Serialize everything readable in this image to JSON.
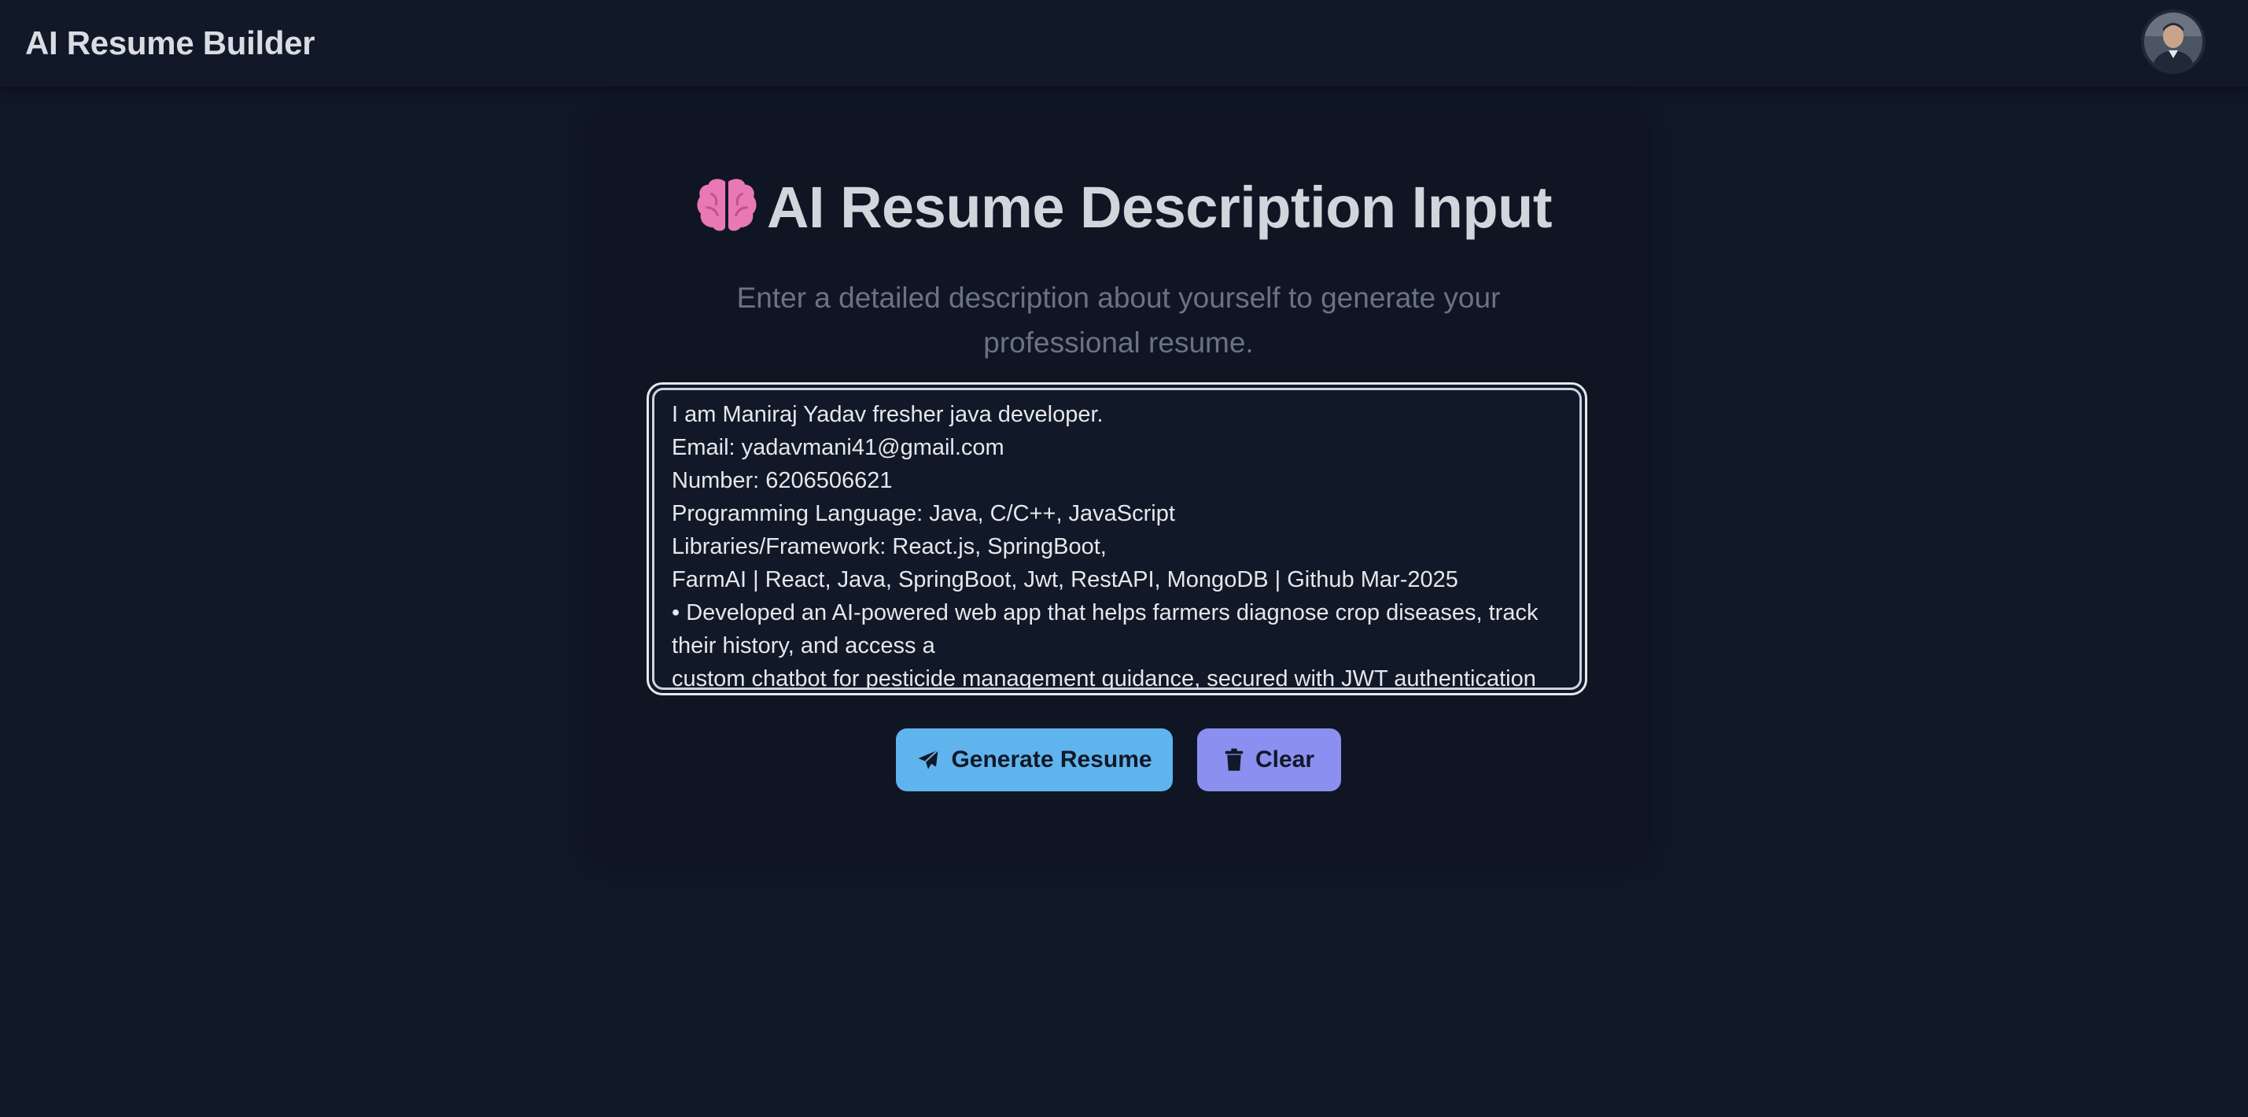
{
  "app": {
    "title": "AI Resume Builder"
  },
  "header": {
    "avatar_alt": "user avatar"
  },
  "form": {
    "title": "AI Resume Description Input",
    "title_icon": "brain-icon",
    "subtitle": "Enter a detailed description about yourself to generate your professional resume.",
    "description_value": "I am Maniraj Yadav fresher java developer.\nEmail: yadavmani41@gmail.com\nNumber: 6206506621\nProgramming Language: Java, C/C++, JavaScript\nLibraries/Framework: React.js, SpringBoot,\nFarmAI | React, Java, SpringBoot, Jwt, RestAPI, MongoDB | Github Mar-2025\n• Developed an AI-powered web app that helps farmers diagnose crop diseases, track their history, and access a\ncustom chatbot for pesticide management guidance, secured with JWT authentication",
    "generate_label": "Generate Resume",
    "generate_icon": "paper-plane-icon",
    "clear_label": "Clear",
    "clear_icon": "trash-icon"
  },
  "colors": {
    "background": "#111827",
    "card": "#0f1523",
    "brain": "#e879b5",
    "generate_button": "#60b4ee",
    "clear_button": "#8b8ff0"
  }
}
